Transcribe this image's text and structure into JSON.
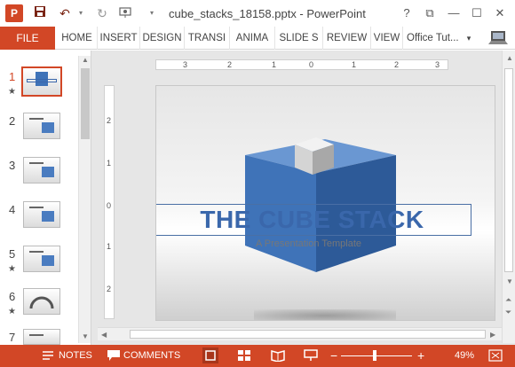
{
  "window": {
    "app_icon_label": "P",
    "title": "cube_stacks_18158.pptx - PowerPoint",
    "help": "?",
    "ribbon_options": "⧉",
    "minimize": "—",
    "maximize": "☐",
    "close": "✕"
  },
  "ribbon": {
    "file": "FILE",
    "tabs": [
      "HOME",
      "INSERT",
      "DESIGN",
      "TRANSI",
      "ANIMA",
      "SLIDE S",
      "REVIEW",
      "VIEW"
    ],
    "user": "Office Tut...",
    "user_dropdown": "▾"
  },
  "thumbnails": [
    {
      "number": "1",
      "star": "★"
    },
    {
      "number": "2",
      "star": ""
    },
    {
      "number": "3",
      "star": ""
    },
    {
      "number": "4",
      "star": ""
    },
    {
      "number": "5",
      "star": "★"
    },
    {
      "number": "6",
      "star": "★"
    },
    {
      "number": "7",
      "star": ""
    }
  ],
  "rulers": {
    "horizontal": [
      "3",
      "2",
      "1",
      "0",
      "1",
      "2",
      "3"
    ],
    "vertical": [
      "2",
      "1",
      "0",
      "1",
      "2"
    ]
  },
  "slide": {
    "title": "THE CUBE STACK",
    "subtitle": "A Presentation Template"
  },
  "status": {
    "notes": "NOTES",
    "comments": "COMMENTS",
    "zoom_out": "−",
    "zoom_in": "+",
    "zoom": "49%",
    "zoom_level": 0.49
  },
  "colors": {
    "accent": "#d24726",
    "title_blue": "#3a67ab",
    "cube_blue": "#3f73b8"
  }
}
